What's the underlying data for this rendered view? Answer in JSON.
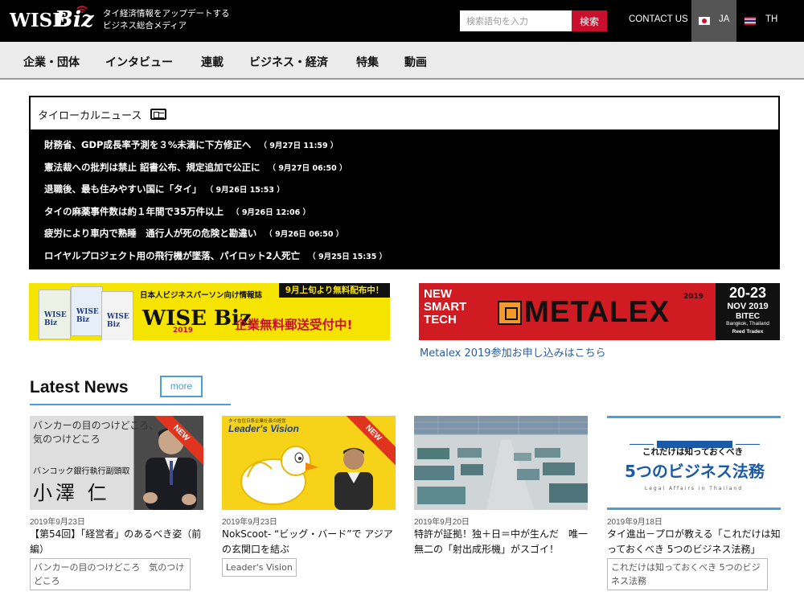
{
  "header": {
    "logo": {
      "wise": "WISE",
      "biz": "Biz"
    },
    "tagline_line1": "タイ経済情報をアップデートする",
    "tagline_line2": "ビジネス総合メディア",
    "search_placeholder": "検索語句を入力",
    "search_button": "検索",
    "contact": "CONTACT US",
    "lang_ja": "JA",
    "lang_th": "TH",
    "active_lang": "JA"
  },
  "nav": {
    "items": [
      "企業・団体",
      "インタビュー",
      "連載",
      "ビジネス・経済",
      "特集",
      "動画"
    ]
  },
  "local_news": {
    "title": "タイローカルニュース",
    "icon": "newspaper-icon",
    "items": [
      {
        "headline": "財務省、GDP成長率予測を３%未満に下方修正へ",
        "time": "（ 9月27日 11:59 ）"
      },
      {
        "headline": "憲法裁への批判は禁止 詔書公布、規定追加で公正に",
        "time": "（ 9月27日 06:50 ）"
      },
      {
        "headline": "退職後、最も住みやすい国に「タイ」",
        "time": "（ 9月26日 15:53 ）"
      },
      {
        "headline": "タイの麻薬事件数は約１年間で35万件以上",
        "time": "（ 9月26日 12:06 ）"
      },
      {
        "headline": "疲労により車内で熟睡　通行人が死の危険と勘違い",
        "time": "（ 9月26日 06:50 ）"
      },
      {
        "headline": "ロイヤルプロジェクト用の飛行機が墜落、パイロット2人死亡",
        "time": "（ 9月25日 15:35 ）"
      }
    ]
  },
  "banners": {
    "left": {
      "tag": "9月上旬より無料配布中！",
      "sub": "日本人ビジネスパーソン向け情報誌",
      "logo": "WISE Biz",
      "year": "2019",
      "text": "企業無料郵送受付中!",
      "book_logo": "WISE Biz"
    },
    "right": {
      "smart_tech": [
        "NEW",
        "SMART",
        "TECH"
      ],
      "brand": "METALEX",
      "year": "2019",
      "dates": "20-23",
      "month": "NOV 2019",
      "venue": "BITEC",
      "city": "Bangkok, Thailand",
      "organizer": "Reed Tradex",
      "link": "Metalex 2019参加お申し込みはこちら"
    }
  },
  "latest_news": {
    "title": "Latest News",
    "more": "more",
    "new_label": "NEW",
    "cards": [
      {
        "date": "2019年9月23日",
        "title": "【第54回】「経営者」のあるべき姿（前編）",
        "tag": "バンカーの目のつけどころ　気のつけどころ",
        "is_new": true,
        "thumb": {
          "quote_line1": "バンカーの目のつけどころ、",
          "quote_line2": "気のつけどころ",
          "rank": "バンコック銀行執行副頭取",
          "name": "小澤 仁"
        }
      },
      {
        "date": "2019年9月23日",
        "title": "NokScoot- “ビッグ・バード”で アジアの玄関口を結ぶ",
        "tag": "Leader's Vision",
        "is_new": true,
        "thumb": {
          "top": "タイ在住日系企業社長の経営",
          "series": "Leader's Vision"
        }
      },
      {
        "date": "2019年9月20日",
        "title": "特許が証拠！独＋日＝中が生んだ　唯一無二の「射出成形機」がスゴイ！",
        "tag": "",
        "is_new": false,
        "thumb": {}
      },
      {
        "date": "2019年9月18日",
        "title": "タイ進出－プロが教える「これだけは知っておくべき 5つのビジネス法務」",
        "tag": "これだけは知っておくべき 5つのビジネス法務",
        "is_new": false,
        "thumb": {
          "sub": "これだけは知っておくべき",
          "title": "5つのビジネス法務",
          "foot": "Legal Affairs in Thailand"
        }
      }
    ]
  },
  "colors": {
    "accent_red": "#c8102e",
    "accent_blue": "#4a9fd8",
    "link_blue": "#2a5d9c",
    "header_bg": "#000000"
  }
}
